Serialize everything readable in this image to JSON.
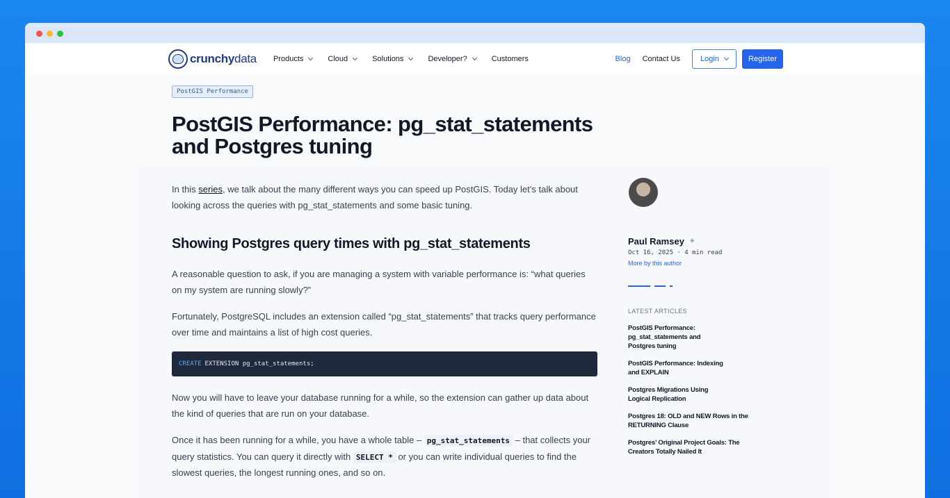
{
  "nav": {
    "logo_bold": "crunchy",
    "logo_light": "data",
    "items": [
      {
        "label": "Products"
      },
      {
        "label": "Cloud"
      },
      {
        "label": "Solutions"
      },
      {
        "label": "Developer?"
      },
      {
        "label": "Customers"
      }
    ],
    "blog": "Blog",
    "contact": "Contact Us",
    "login": "Login",
    "register": "Register"
  },
  "article": {
    "tag": "PostGIS Performance",
    "title": "PostGIS Performance: pg_stat_statements and Postgres tuning",
    "intro_pre": "In this ",
    "intro_link": "series",
    "intro_post": ", we talk about the many different ways you can speed up PostGIS. Today let’s talk about looking across the queries with pg_stat_statements and some basic tuning.",
    "h2": "Showing Postgres query times with pg_stat_statements",
    "p1": "A reasonable question to ask, if you are managing a system with variable performance is: “what queries on my system are running slowly?”",
    "p2": "Fortunately, PostgreSQL includes an extension called “pg_stat_statements” that tracks query performance over time and maintains a list of high cost queries.",
    "code_keyword": "CREATE",
    "code_rest": "EXTENSION pg_stat_statements;",
    "p3": "Now you will have to leave your database running for a while, so the extension can gather up data about the kind of queries that are run on your database.",
    "p4_a": "Once it has been running for a while, you have a whole table – ",
    "p4_code1": "pg_stat_statements",
    "p4_b": " – that collects your query statistics. You can query it directly with ",
    "p4_code2": "SELECT *",
    "p4_c": " or you can write individual queries to find the slowest queries, the longest running ones, and so on."
  },
  "sidebar": {
    "author": "Paul Ramsey",
    "meta": "Oct 16, 2025 · 4 min read",
    "more": "More by this author",
    "latest_title": "LATEST ARTICLES",
    "latest": [
      "PostGIS Performance: pg_stat_statements and Postgres tuning",
      "PostGIS Performance: Indexing and EXPLAIN",
      "Postgres Migrations Using Logical Replication",
      "Postgres 18: OLD and NEW Rows in the RETURNING Clause",
      "Postgres’ Original Project Goals: The Creators Totally Nailed It"
    ]
  }
}
